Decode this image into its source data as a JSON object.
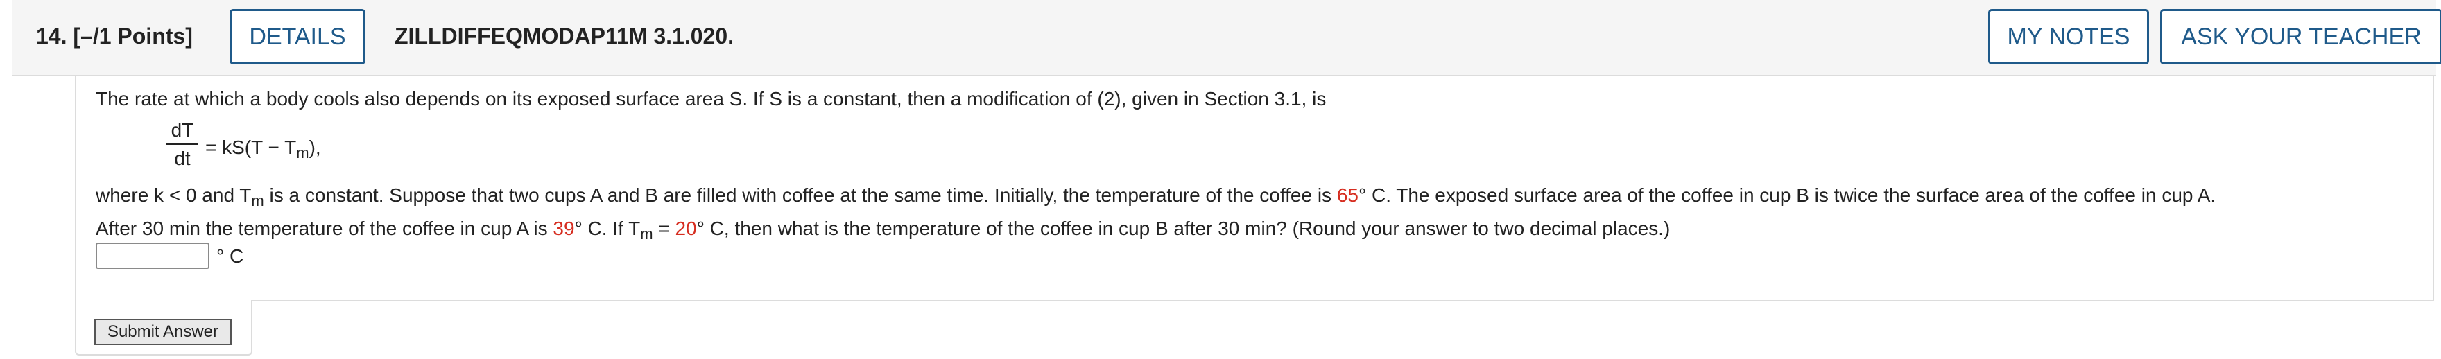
{
  "header": {
    "question_label": "14. [–/1 Points]",
    "details_label": "DETAILS",
    "question_code": "ZILLDIFFEQMODAP11M 3.1.020.",
    "my_notes_label": "MY NOTES",
    "ask_teacher_label": "ASK YOUR TEACHER"
  },
  "problem": {
    "line1": "The rate at which a body cools also depends on its exposed surface area S. If S is a constant, then a modification of (2), given in Section 3.1, is",
    "formula": {
      "numerator": "dT",
      "denominator": "dt",
      "rhs_prefix": "= kS(T − T",
      "rhs_sub": "m",
      "rhs_suffix": "),"
    },
    "line3_a": "where k < 0 and T",
    "line3_sub": "m",
    "line3_b": " is a constant. Suppose that two cups A and B are filled with coffee at the same time. Initially, the temperature of the coffee is ",
    "initial_temp": "65",
    "line3_c": "° C. The exposed surface area of the coffee in cup B is twice the surface area of the coffee in cup A.",
    "line4_a": "After 30 min the temperature of the coffee in cup A is ",
    "temp_after": "39",
    "line4_b": "° C. If T",
    "line4_sub": "m",
    "line4_c": " = ",
    "ambient_temp": "20",
    "line4_d": "° C, then what is the temperature of the coffee in cup B after 30 min? (Round your answer to two decimal places.)"
  },
  "answer": {
    "value": "",
    "unit": "° C"
  },
  "submit_label": "Submit Answer",
  "colors": {
    "accent": "#1f5a8a",
    "highlight": "#d62d20",
    "header_bg": "#f5f5f5"
  }
}
